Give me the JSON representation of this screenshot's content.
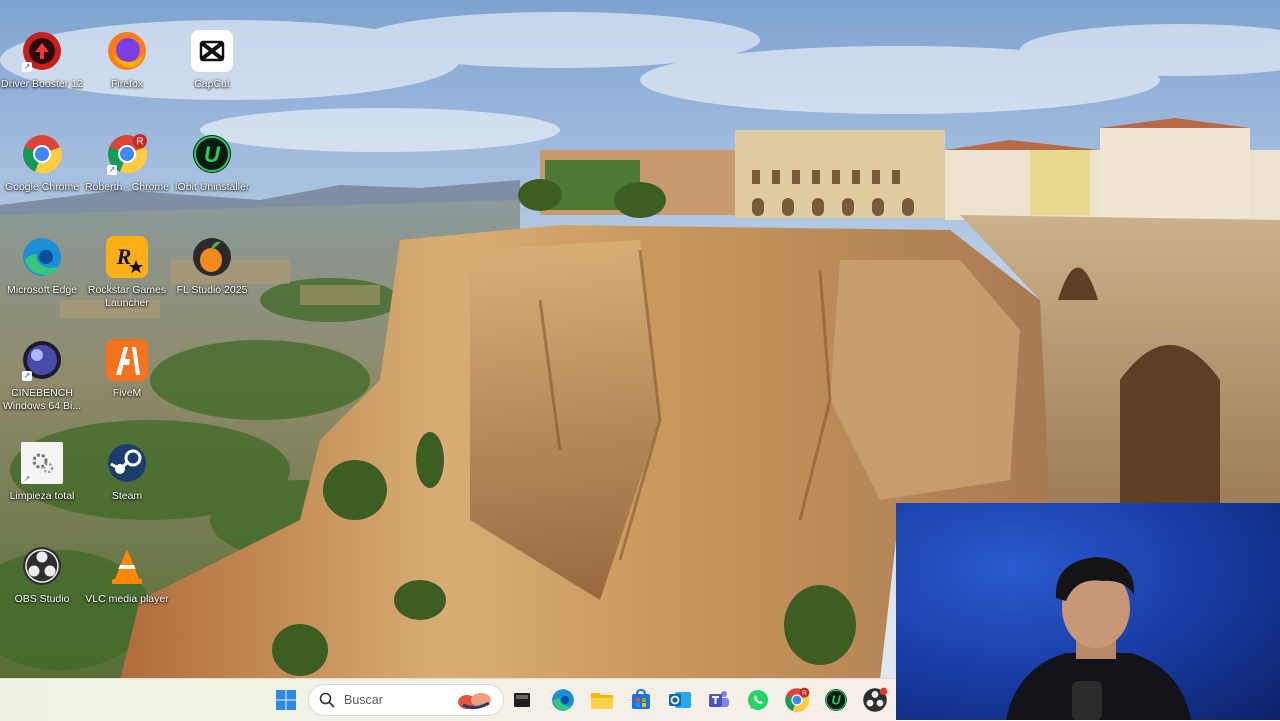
{
  "desktop": {
    "icons": [
      {
        "label": "Driver Booster 12",
        "icon": "driver-booster-icon"
      },
      {
        "label": "Firefox",
        "icon": "firefox-icon"
      },
      {
        "label": "CapCut",
        "icon": "capcut-icon"
      },
      {
        "label": "Google Chrome",
        "icon": "chrome-icon"
      },
      {
        "label": "Roberth - Chrome",
        "icon": "chrome-profile-icon",
        "badge": "R"
      },
      {
        "label": "IObit Uninstaller",
        "icon": "iobit-uninstaller-icon",
        "glyph": "U"
      },
      {
        "label": "Microsoft Edge",
        "icon": "edge-icon"
      },
      {
        "label": "Rockstar Games Launcher",
        "icon": "rockstar-icon",
        "glyph": "R"
      },
      {
        "label": "FL Studio 2025",
        "icon": "fl-studio-icon"
      },
      {
        "label": "CINEBENCH Windows 64 Bi...",
        "icon": "cinebench-icon"
      },
      {
        "label": "FiveM",
        "icon": "fivem-icon"
      },
      {
        "label": "Limpieza total",
        "icon": "cleanup-shortcut-icon"
      },
      {
        "label": "Steam",
        "icon": "steam-icon"
      },
      {
        "label": "OBS Studio",
        "icon": "obs-icon"
      },
      {
        "label": "VLC media player",
        "icon": "vlc-icon"
      }
    ]
  },
  "taskbar": {
    "search_placeholder": "Buscar",
    "pinned": [
      {
        "icon": "windows-start-icon"
      },
      {
        "icon": "task-view-icon"
      },
      {
        "icon": "edge-icon"
      },
      {
        "icon": "file-explorer-icon"
      },
      {
        "icon": "microsoft-store-icon"
      },
      {
        "icon": "outlook-icon"
      },
      {
        "icon": "teams-icon"
      },
      {
        "icon": "whatsapp-icon"
      },
      {
        "icon": "chrome-profile-icon",
        "badge": "R"
      },
      {
        "icon": "iobit-uninstaller-icon",
        "glyph": "U"
      },
      {
        "icon": "obs-icon"
      }
    ]
  },
  "colors": {
    "taskbar_bg": "#f1f2e8",
    "webcam_bg": "#1c45b4",
    "sky": "#8fb4dc"
  }
}
